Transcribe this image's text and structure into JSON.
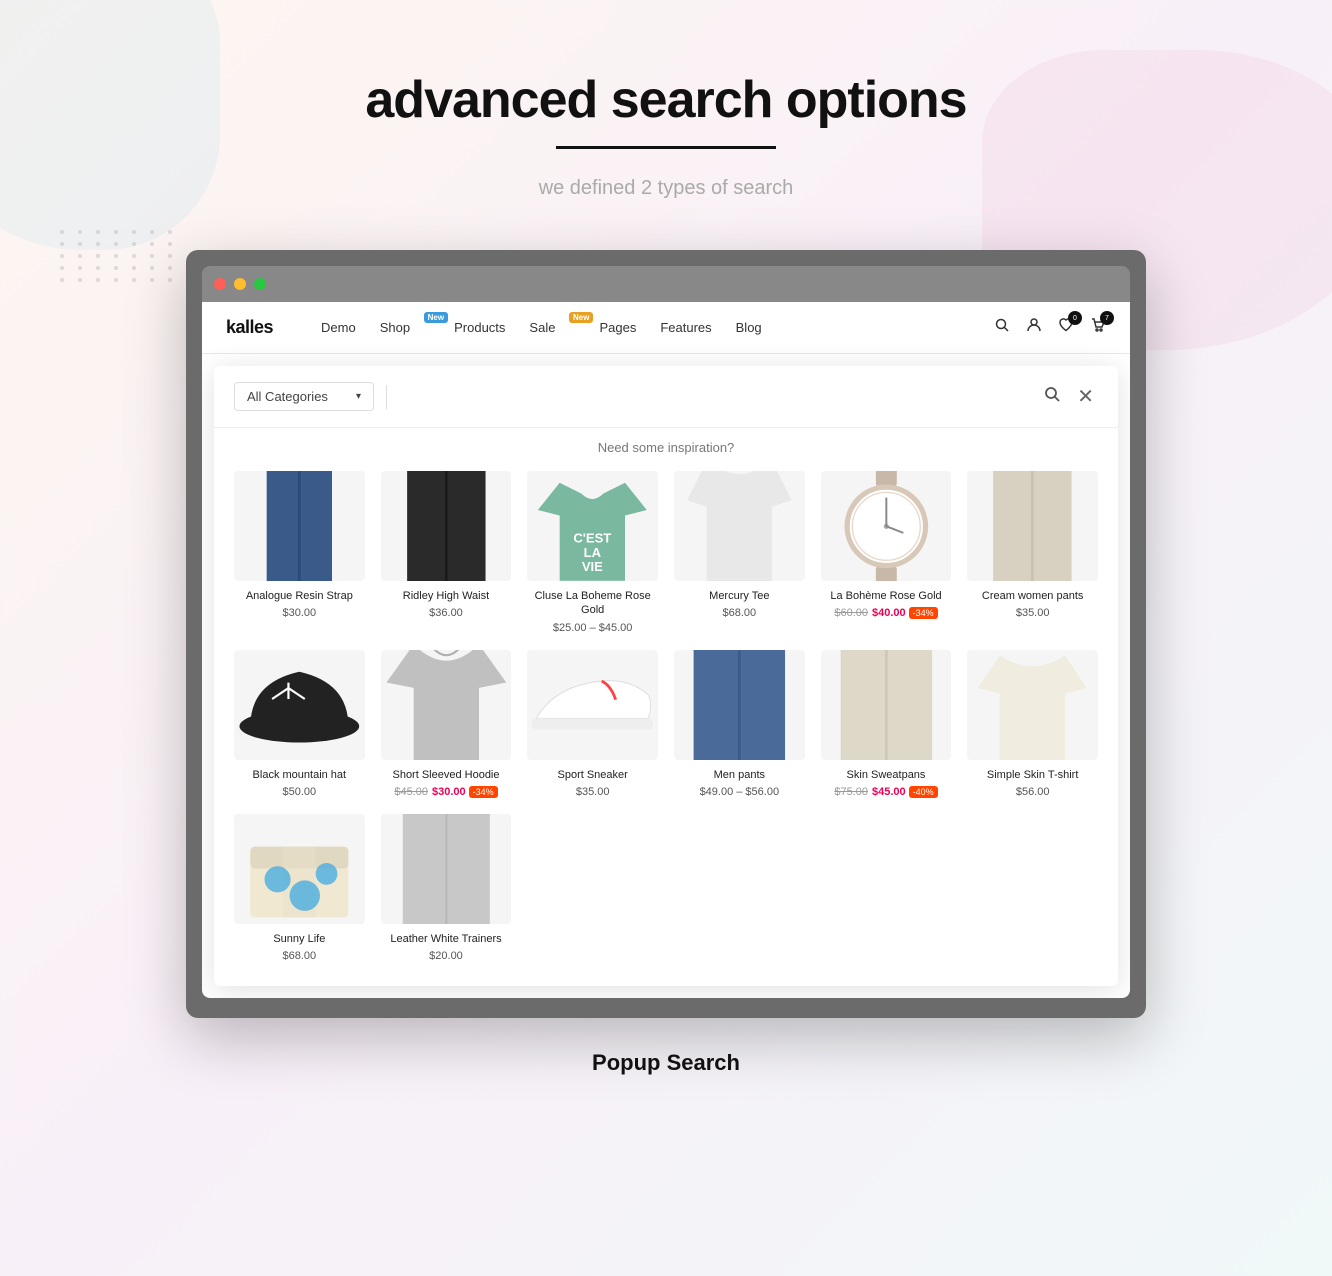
{
  "page": {
    "title": "advanced search  options",
    "underline": true,
    "subtitle": "we defined 2 types of search",
    "popup_label": "Popup Search"
  },
  "nav": {
    "logo": "kalles",
    "links": [
      {
        "label": "Demo",
        "badge": null
      },
      {
        "label": "Shop",
        "badge": "New"
      },
      {
        "label": "Products",
        "badge": null
      },
      {
        "label": "Sale",
        "badge": "New"
      },
      {
        "label": "Pages",
        "badge": null
      },
      {
        "label": "Features",
        "badge": null
      },
      {
        "label": "Blog",
        "badge": null
      }
    ],
    "icons": [
      {
        "name": "search",
        "symbol": "🔍",
        "count": null
      },
      {
        "name": "user",
        "symbol": "👤",
        "count": null
      },
      {
        "name": "wishlist",
        "symbol": "♡",
        "count": "0"
      },
      {
        "name": "cart",
        "symbol": "🛒",
        "count": "7"
      }
    ]
  },
  "search": {
    "categories_label": "All Categories",
    "placeholder": "",
    "inspiration_text": "Need some inspiration?"
  },
  "products": [
    {
      "name": "Analogue Resin Strap",
      "price_regular": "$30.00",
      "price_sale": null,
      "badge": null,
      "img_class": "img-jeans",
      "svg_type": "jeans"
    },
    {
      "name": "Ridley High Waist",
      "price_regular": "$36.00",
      "price_sale": null,
      "badge": null,
      "img_class": "img-pants-black",
      "svg_type": "pants-black"
    },
    {
      "name": "Cluse La Boheme Rose Gold",
      "price_regular": "$25.00 – $45.00",
      "price_sale": null,
      "badge": null,
      "img_class": "img-tshirt-green",
      "svg_type": "tshirt-green"
    },
    {
      "name": "Mercury Tee",
      "price_regular": "$68.00",
      "price_sale": null,
      "badge": null,
      "img_class": "img-sweater-white",
      "svg_type": "sweater-white"
    },
    {
      "name": "La Bohème Rose Gold",
      "price_original": "$60.00",
      "price_regular": "$40.00",
      "price_sale": "$40.00",
      "badge": "-34%",
      "img_class": "img-watch",
      "svg_type": "watch"
    },
    {
      "name": "Cream women pants",
      "price_regular": "$35.00",
      "price_sale": null,
      "badge": null,
      "img_class": "img-pants-cream",
      "svg_type": "pants-cream"
    },
    {
      "name": "Black mountain hat",
      "price_regular": "$50.00",
      "price_sale": null,
      "badge": null,
      "img_class": "img-hat",
      "svg_type": "hat"
    },
    {
      "name": "Short Sleeved Hoodie",
      "price_original": "$45.00",
      "price_regular": "$30.00",
      "price_sale": "$30.00",
      "badge": "-34%",
      "img_class": "img-hoodie",
      "svg_type": "hoodie"
    },
    {
      "name": "Sport Sneaker",
      "price_regular": "$35.00",
      "price_sale": null,
      "badge": null,
      "img_class": "img-sneaker",
      "svg_type": "sneaker"
    },
    {
      "name": "Men pants",
      "price_regular": "$49.00 – $56.00",
      "price_sale": null,
      "badge": null,
      "img_class": "img-jeans2",
      "svg_type": "jeans2"
    },
    {
      "name": "Skin Sweatpans",
      "price_original": "$75.00",
      "price_regular": "$45.00",
      "price_sale": "$45.00",
      "badge": "-40%",
      "img_class": "img-sweatpants",
      "svg_type": "sweatpants"
    },
    {
      "name": "Simple Skin T-shirt",
      "price_regular": "$56.00",
      "price_sale": null,
      "badge": null,
      "img_class": "img-tshirt-cream",
      "svg_type": "tshirt-cream"
    },
    {
      "name": "Sunny Life",
      "price_regular": "$68.00",
      "price_sale": null,
      "badge": null,
      "img_class": "img-box",
      "svg_type": "box"
    },
    {
      "name": "Leather White Trainers",
      "price_regular": "$20.00",
      "price_sale": null,
      "badge": null,
      "img_class": "img-trackpants",
      "svg_type": "trainers"
    }
  ]
}
